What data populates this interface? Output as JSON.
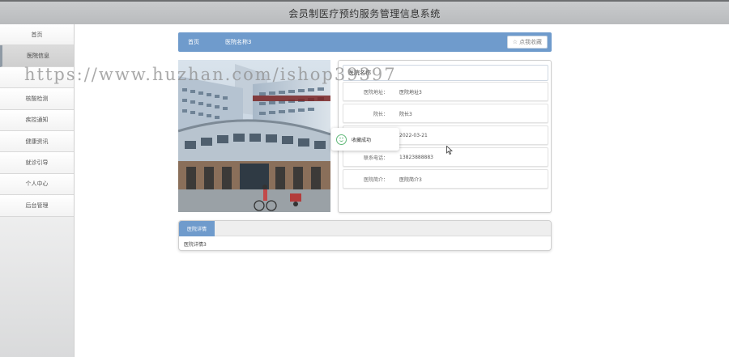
{
  "header": {
    "title": "会员制医疗预约服务管理信息系统"
  },
  "sidebar": {
    "items": [
      {
        "label": "首页"
      },
      {
        "label": "医院信息"
      },
      {
        "label": ""
      },
      {
        "label": "核酸检测"
      },
      {
        "label": "疾控通知"
      },
      {
        "label": "健康资讯"
      },
      {
        "label": "就诊引导"
      },
      {
        "label": "个人中心"
      },
      {
        "label": "后台管理"
      }
    ]
  },
  "breadcrumb": {
    "home": "首页",
    "current": "医院名称3"
  },
  "favorite_button": {
    "label": "点我收藏"
  },
  "info": {
    "heading": "医院名称",
    "rows": [
      {
        "label": "医院地址：",
        "value": "医院地址3"
      },
      {
        "label": "院长：",
        "value": "院长3"
      },
      {
        "label": "",
        "value": "2022-03-21"
      },
      {
        "label": "联系电话：",
        "value": "13823888883"
      },
      {
        "label": "医院简介：",
        "value": "医院简介3"
      }
    ]
  },
  "toast": {
    "message": "收藏成功"
  },
  "detail": {
    "tab": "医院详情",
    "text": "医院详情3"
  },
  "watermark": {
    "text": "https://www.huzhan.com/ishop39397"
  },
  "colors": {
    "accent": "#6f9bcc",
    "success": "#5fb878"
  }
}
